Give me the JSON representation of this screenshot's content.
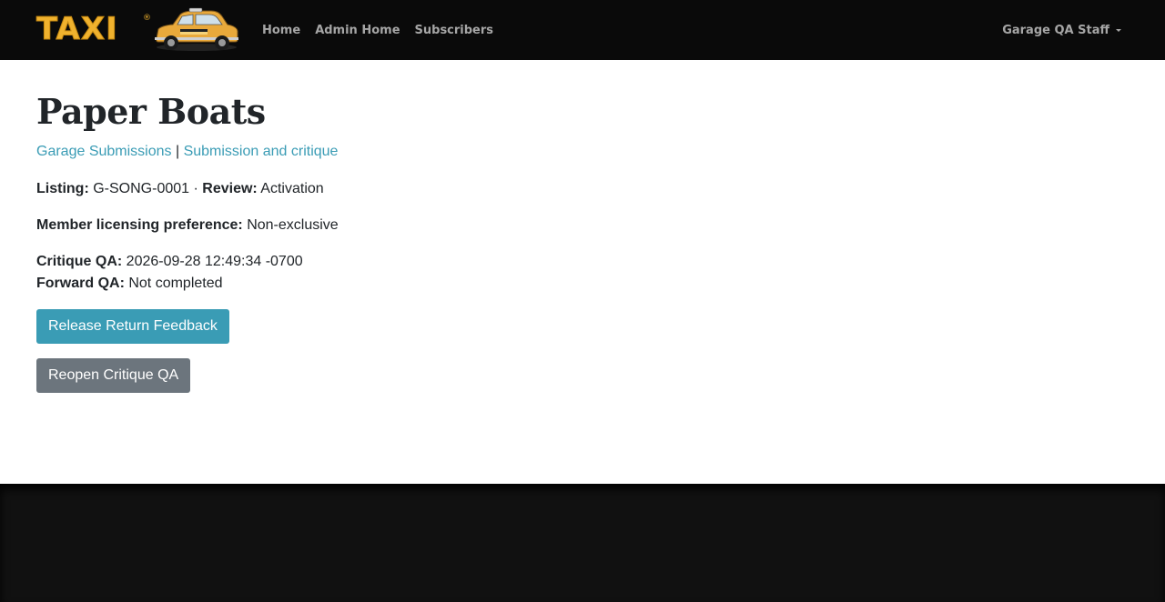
{
  "navbar": {
    "logo_text": "TAXI",
    "logo_reg": "®",
    "links": [
      "Home",
      "Admin Home",
      "Subscribers"
    ],
    "user_menu": "Garage QA Staff"
  },
  "page": {
    "title": "Paper Boats",
    "breadcrumbs": {
      "first": "Garage Submissions",
      "separator": "|",
      "second": "Submission and critique"
    },
    "listing_label": "Listing:",
    "listing_value": "G-SONG-0001",
    "dot": "·",
    "review_label": "Review:",
    "review_value": "Activation",
    "licensing_label": "Member licensing preference:",
    "licensing_value": "Non-exclusive",
    "critique_label": "Critique QA:",
    "critique_value": "2026-09-28 12:49:34 -0700",
    "forward_label": "Forward QA:",
    "forward_value": "Not completed",
    "release_button": "Release Return Feedback",
    "reopen_button": "Reopen Critique QA"
  },
  "colors": {
    "navbar_bg": "#0a0a0a",
    "link": "#3a9cb5",
    "primary_button": "#3a9cb5",
    "secondary_button": "#6c757d",
    "footer_bg": "#111111",
    "logo": "#f0b22e"
  },
  "icons": {
    "logo_car": "taxi-cab-icon",
    "user_caret": "caret-down-icon"
  }
}
